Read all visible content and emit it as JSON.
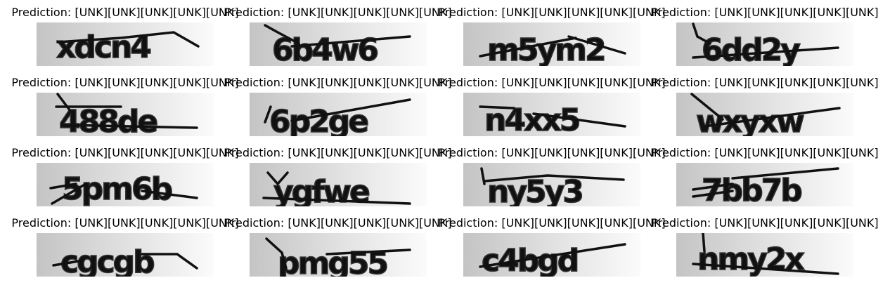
{
  "panels": [
    {
      "title": "Prediction: [UNK][UNK][UNK][UNK][UNK]",
      "captcha_text": "xdcn4"
    },
    {
      "title": "Prediction: [UNK][UNK][UNK][UNK][UNK]",
      "captcha_text": "6b4w6"
    },
    {
      "title": "Prediction: [UNK][UNK][UNK][UNK][UNK]",
      "captcha_text": "m5ym2"
    },
    {
      "title": "Prediction: [UNK][UNK][UNK][UNK][UNK]",
      "captcha_text": "6dd2y"
    },
    {
      "title": "Prediction: [UNK][UNK][UNK][UNK][UNK]",
      "captcha_text": "488de"
    },
    {
      "title": "Prediction: [UNK][UNK][UNK][UNK][UNK]",
      "captcha_text": "6p2ge"
    },
    {
      "title": "Prediction: [UNK][UNK][UNK][UNK][UNK]",
      "captcha_text": "n4xx5"
    },
    {
      "title": "Prediction: [UNK][UNK][UNK][UNK][UNK]",
      "captcha_text": "wxyxw"
    },
    {
      "title": "Prediction: [UNK][UNK][UNK][UNK][UNK]",
      "captcha_text": "5pm6b"
    },
    {
      "title": "Prediction: [UNK][UNK][UNK][UNK][UNK]",
      "captcha_text": "ygfwe"
    },
    {
      "title": "Prediction: [UNK][UNK][UNK][UNK][UNK]",
      "captcha_text": "ny5y3"
    },
    {
      "title": "Prediction: [UNK][UNK][UNK][UNK][UNK]",
      "captcha_text": "7bb7b"
    },
    {
      "title": "Prediction: [UNK][UNK][UNK][UNK][UNK]",
      "captcha_text": "cgcgb"
    },
    {
      "title": "Prediction: [UNK][UNK][UNK][UNK][UNK]",
      "captcha_text": "pmg55"
    },
    {
      "title": "Prediction: [UNK][UNK][UNK][UNK][UNK]",
      "captcha_text": "c4bgd"
    },
    {
      "title": "Prediction: [UNK][UNK][UNK][UNK][UNK]",
      "captcha_text": "nmy2x"
    }
  ]
}
